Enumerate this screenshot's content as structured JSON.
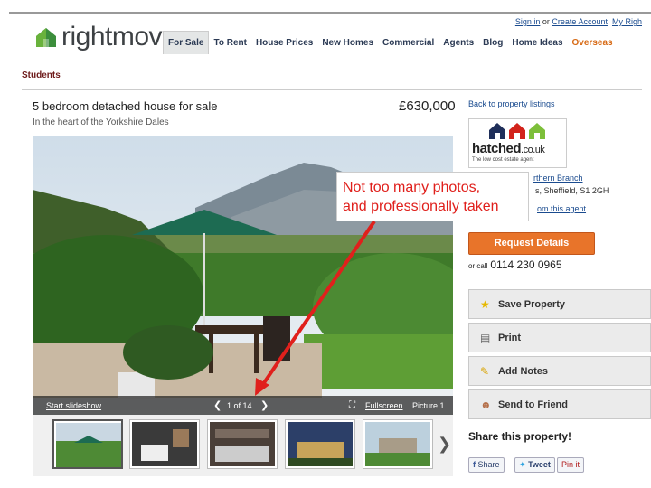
{
  "header": {
    "logo_text": "rightmove",
    "nav": [
      "For Sale",
      "To Rent",
      "House Prices",
      "New Homes",
      "Commercial",
      "Agents",
      "Blog",
      "Home Ideas",
      "Overseas"
    ],
    "util": {
      "sign_in": "Sign in",
      "or": "or",
      "create": "Create Account",
      "my": "My Righ"
    }
  },
  "breadcrumb": {
    "students": "Students"
  },
  "listing": {
    "title": "5 bedroom detached house for sale",
    "subtitle": "In the heart of the Yorkshire Dales",
    "price": "£630,000"
  },
  "photo": {
    "start_slideshow": "Start slideshow",
    "counter": "1 of 14",
    "fullscreen": "Fullscreen",
    "picture_label": "Picture 1",
    "prev_icon": "chevron-left-icon",
    "next_icon": "chevron-right-icon"
  },
  "agent": {
    "back_link": "Back to property listings",
    "logo_word": "hatched",
    "logo_suffix": ".co.uk",
    "logo_tagline": "The low cost estate agent",
    "branch": "rthern Branch",
    "address": "s, Sheffield, S1 2GH",
    "more": "om this agent",
    "request": "Request Details",
    "or_call": "or call",
    "phone": "0114 230 0965"
  },
  "actions": [
    {
      "label": "Save Property",
      "icon": "star-icon"
    },
    {
      "label": "Print",
      "icon": "printer-icon"
    },
    {
      "label": "Add Notes",
      "icon": "pencil-icon"
    },
    {
      "label": "Send to Friend",
      "icon": "person-icon"
    }
  ],
  "share": {
    "title": "Share this property!",
    "facebook": "Share",
    "twitter": "Tweet",
    "pinterest": "Pin it"
  },
  "annotation": {
    "line1": "Not too many photos,",
    "line2": "and professionally taken"
  },
  "colors": {
    "nav_text": "#2b3a54",
    "overseas": "#d76a15",
    "request_btn": "#e8742a",
    "annotation": "#e0201c",
    "logo_green": "#3c8e3c"
  }
}
